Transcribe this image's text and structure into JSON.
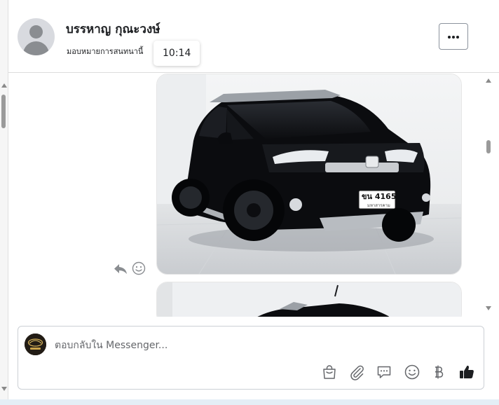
{
  "conversation": {
    "contact_name": "บรรหาญ กุณะวงษ์",
    "subtitle": "มอบหมายการสนทนานี้",
    "time_tooltip": "10:14"
  },
  "header": {
    "more_icon": "more-horizontal-icon"
  },
  "messages": [
    {
      "type": "image",
      "description": "photo-1",
      "actions": [
        "reply-icon",
        "emoji-icon"
      ]
    },
    {
      "type": "image",
      "description": "photo-2"
    }
  ],
  "composer": {
    "placeholder": "ตอบกลับใน Messenger...",
    "tools": [
      "shopping-bag-icon",
      "paperclip-icon",
      "saved-reply-icon",
      "emoji-icon",
      "baht-icon",
      "thumbs-up-icon"
    ]
  },
  "colors": {
    "accent": "#1b74e4",
    "border": "#ccd0d5",
    "icon": "#65676b",
    "like_dark": "#1c1e21"
  }
}
